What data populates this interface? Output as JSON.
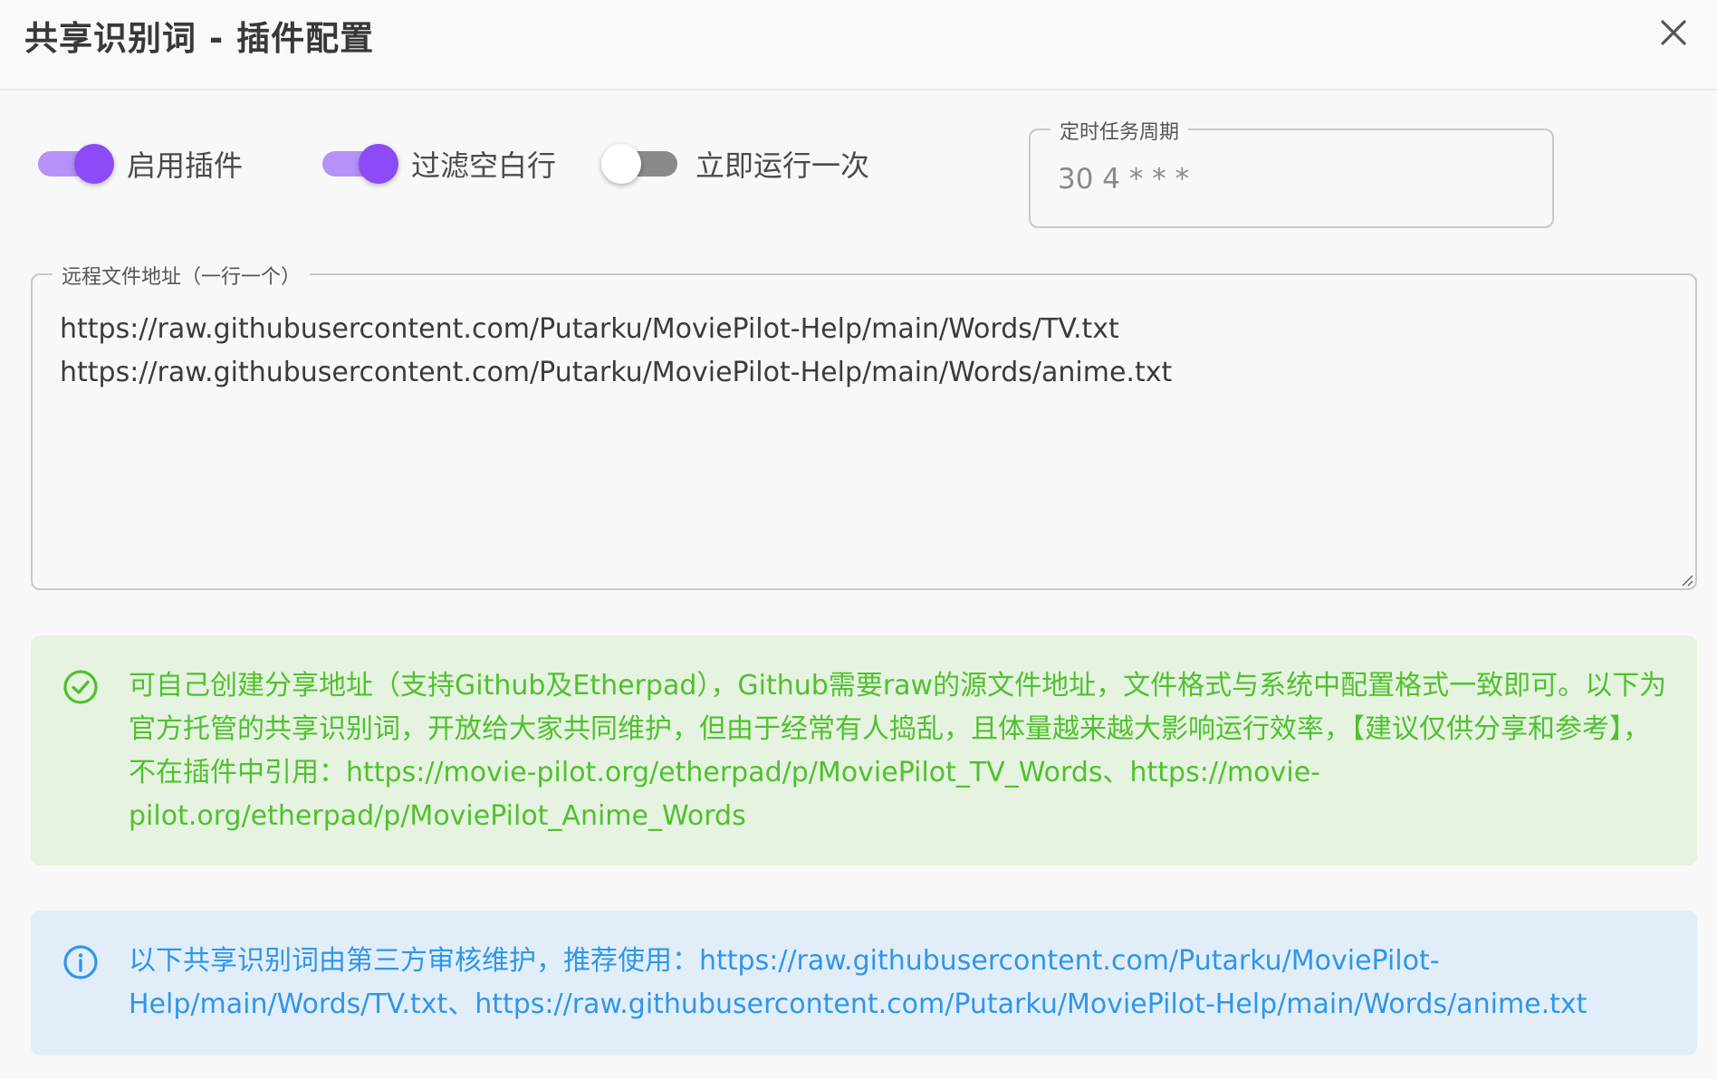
{
  "header": {
    "title": "共享识别词 - 插件配置"
  },
  "switches": [
    {
      "label": "启用插件",
      "checked": true
    },
    {
      "label": "过滤空白行",
      "checked": true
    },
    {
      "label": "立即运行一次",
      "checked": false
    }
  ],
  "cron": {
    "label": "定时任务周期",
    "value": "30 4 * * *"
  },
  "urls": {
    "label": "远程文件地址（一行一个）",
    "lines": [
      "https://raw.githubusercontent.com/Putarku/MoviePilot-Help/main/Words/TV.txt",
      "https://raw.githubusercontent.com/Putarku/MoviePilot-Help/main/Words/anime.txt"
    ]
  },
  "alerts": {
    "success": {
      "icon": "check-circle-icon",
      "color": "#4fc12e",
      "text": "可自己创建分享地址（支持Github及Etherpad），Github需要raw的源文件地址，文件格式与系统中配置格式一致即可。以下为官方托管的共享识别词，开放给大家共同维护，但由于经常有人捣乱，且体量越来越大影响运行效率，【建议仅供分享和参考】，不在插件中引用：https://movie-pilot.org/etherpad/p/MoviePilot_TV_Words、https://movie-pilot.org/etherpad/p/MoviePilot_Anime_Words"
    },
    "info": {
      "icon": "info-circle-icon",
      "color": "#2f96ea",
      "text": "以下共享识别词由第三方审核维护，推荐使用：https://raw.githubusercontent.com/Putarku/MoviePilot-Help/main/Words/TV.txt、https://raw.githubusercontent.com/Putarku/MoviePilot-Help/main/Words/anime.txt"
    }
  },
  "colors": {
    "accent": "#8c4bf6",
    "accent_track": "#b692f8"
  }
}
